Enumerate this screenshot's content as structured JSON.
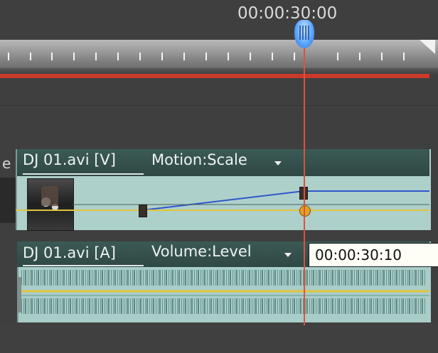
{
  "ruler": {
    "current_time": "00:00:30:00"
  },
  "video_track": {
    "clip_name": "DJ 01.avi [V]",
    "effect_property": "Motion:Scale",
    "cut_off_label": "e"
  },
  "audio_track": {
    "clip_name": "DJ 01.avi [A]",
    "effect_property": "Volume:Level"
  },
  "tooltip": {
    "timecode": "00:00:30:10"
  },
  "colors": {
    "playhead": "#e0503c",
    "work_area_bar": "#c93a2b",
    "track_clip_fill": "#aed0cb",
    "rubber_band_blue": "#2f58c9",
    "rubber_band_yellow": "#e2c43a",
    "keyframe_active": "#e2a227"
  },
  "icons": {
    "playhead": "playhead-handle-icon",
    "ruler_end": "work-area-end-icon",
    "dropdown": "chevron-down-icon",
    "keyframe": "keyframe-icon"
  }
}
